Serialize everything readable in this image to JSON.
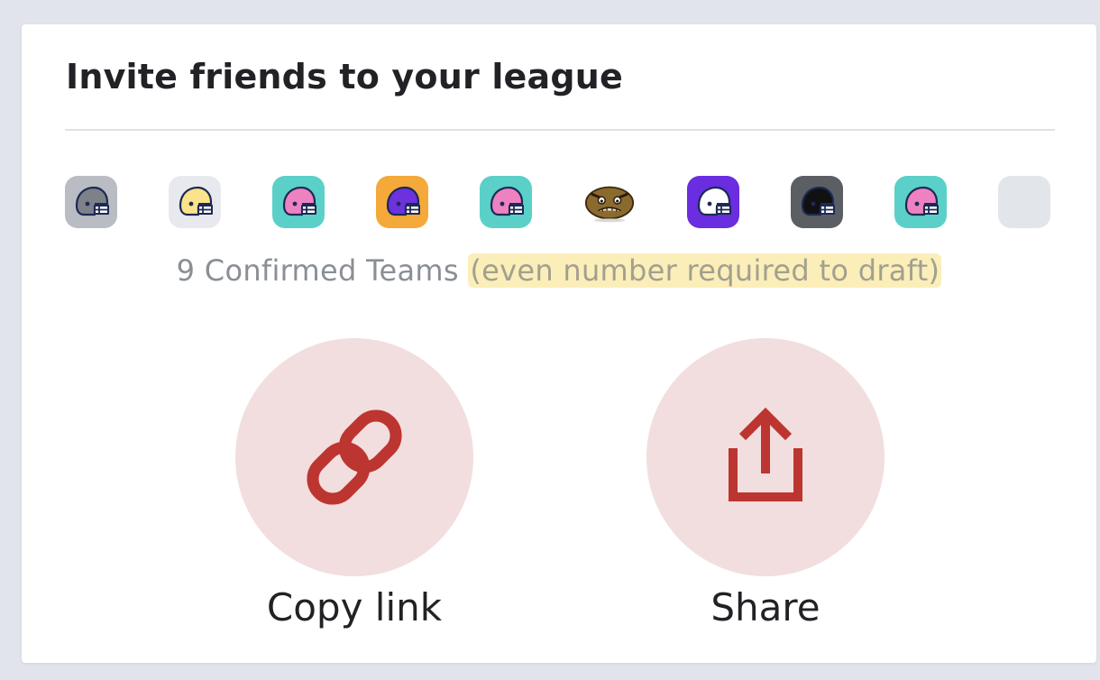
{
  "invite": {
    "title": "Invite friends to your league",
    "teams": [
      {
        "icon": "helmet-icon",
        "bg": "#b9bcc2",
        "shell": "#7d8188"
      },
      {
        "icon": "helmet-icon",
        "bg": "#e7e9ee",
        "shell": "#fae38a"
      },
      {
        "icon": "helmet-icon",
        "bg": "#5bd0c8",
        "shell": "#ee82c0"
      },
      {
        "icon": "helmet-icon",
        "bg": "#f4a93a",
        "shell": "#6d31de"
      },
      {
        "icon": "helmet-icon",
        "bg": "#5bd0c8",
        "shell": "#ee82c0"
      },
      {
        "icon": "angry-football-icon",
        "bg": "#ffffff",
        "shell": "#8b6a2e"
      },
      {
        "icon": "helmet-icon",
        "bg": "#6a2de0",
        "shell": "#ffffff"
      },
      {
        "icon": "helmet-icon",
        "bg": "#5b5f63",
        "shell": "#111111"
      },
      {
        "icon": "helmet-icon",
        "bg": "#5bd0c8",
        "shell": "#ee82c0"
      },
      {
        "icon": "empty-slot",
        "bg": "#e2e5ea",
        "shell": ""
      }
    ],
    "status": {
      "count_text": "9 Confirmed Teams",
      "note": "(even number required to draft)"
    },
    "actions": {
      "copy_label": "Copy link",
      "share_label": "Share"
    },
    "colors": {
      "accent": "#bd3530",
      "action_bg": "#f2dede",
      "highlight": "#fbeeb9"
    }
  }
}
